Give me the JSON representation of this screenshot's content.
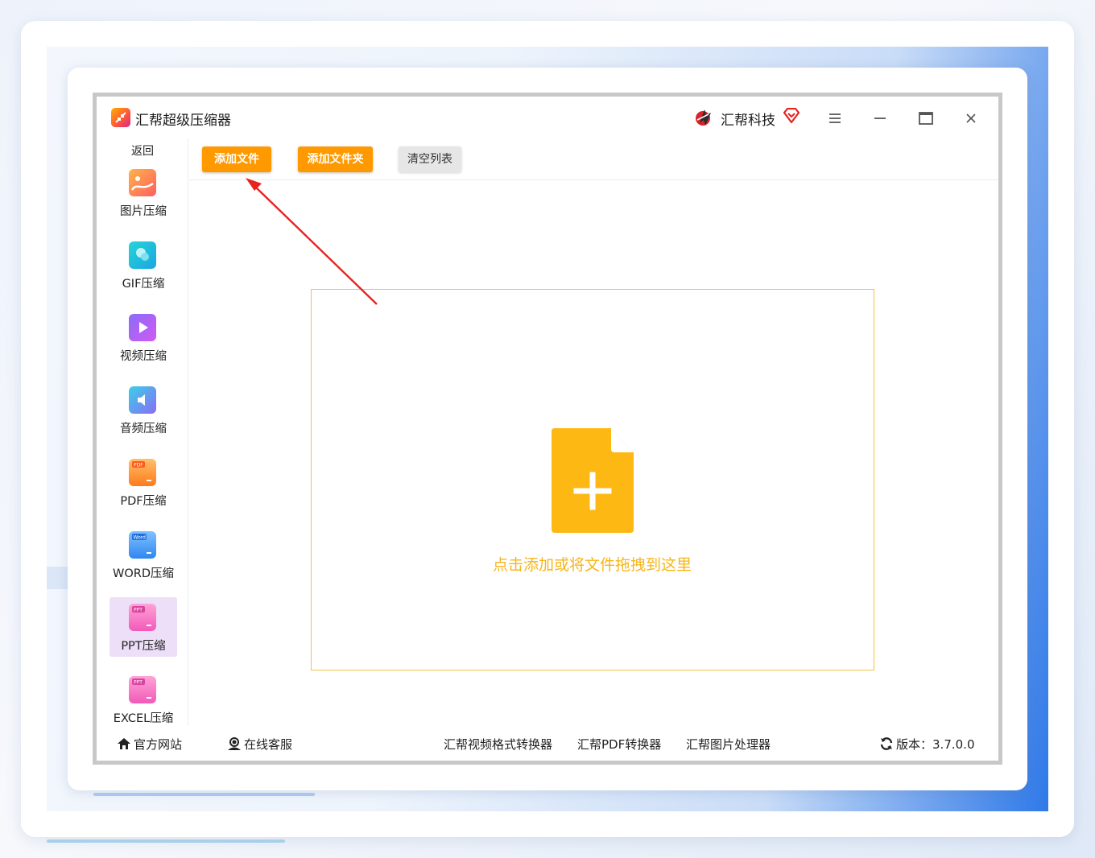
{
  "app": {
    "title": "汇帮超级压缩器",
    "brand": "汇帮科技"
  },
  "sidebar": {
    "back": "返回",
    "items": [
      {
        "label": "图片压缩",
        "icon": "image-compress-icon",
        "active": false
      },
      {
        "label": "GIF压缩",
        "icon": "gif-compress-icon",
        "active": false
      },
      {
        "label": "视频压缩",
        "icon": "video-compress-icon",
        "active": false
      },
      {
        "label": "音频压缩",
        "icon": "audio-compress-icon",
        "active": false
      },
      {
        "label": "PDF压缩",
        "icon": "pdf-compress-icon",
        "active": false
      },
      {
        "label": "WORD压缩",
        "icon": "word-compress-icon",
        "active": false
      },
      {
        "label": "PPT压缩",
        "icon": "ppt-compress-icon",
        "active": true
      },
      {
        "label": "EXCEL压缩",
        "icon": "excel-compress-icon",
        "active": false
      }
    ]
  },
  "toolbar": {
    "add_file": "添加文件",
    "add_folder": "添加文件夹",
    "clear_list": "清空列表"
  },
  "dropzone": {
    "hint": "点击添加或将文件拖拽到这里"
  },
  "footer": {
    "website": "官方网站",
    "support": "在线客服",
    "link_video": "汇帮视频格式转换器",
    "link_pdf": "汇帮PDF转换器",
    "link_image": "汇帮图片处理器",
    "version_label": "版本：",
    "version": "3.7.0.0"
  },
  "colors": {
    "accent_orange": "#ff9900",
    "dropzone_border": "#f4c340",
    "hint_text": "#f7b51a",
    "active_nav_bg": "#eddff8",
    "annotation_arrow": "#e8231f"
  }
}
